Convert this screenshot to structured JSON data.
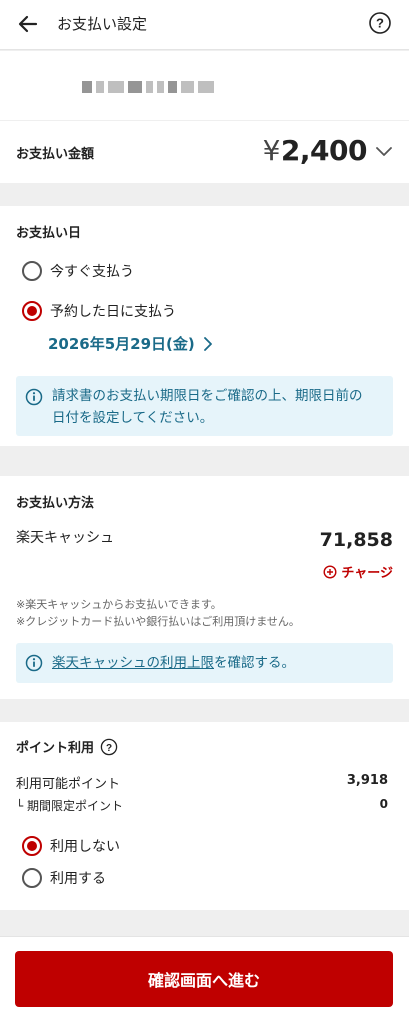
{
  "header": {
    "title": "お支払い設定"
  },
  "payee": {
    "masked_segments": [
      10,
      8,
      16,
      14,
      7,
      7,
      9,
      13,
      16
    ]
  },
  "amount": {
    "label": "お支払い金額",
    "currency": "¥",
    "value": "2,400"
  },
  "payment_date": {
    "title": "お支払い日",
    "options": [
      {
        "label": "今すぐ支払う",
        "checked": false
      },
      {
        "label": "予約した日に支払う",
        "checked": true
      }
    ],
    "selected_date": "2026年5月29日(金)",
    "info": "請求書のお支払い期限日をご確認の上、期限日前の日付を設定してください。",
    "info_line1": "請求書のお支払い期限日をご確認の上、期限日前の",
    "info_line2": "日付を設定してください。"
  },
  "payment_method": {
    "title": "お支払い方法",
    "method_name": "楽天キャッシュ",
    "balance": "71,858",
    "charge_label": "チャージ",
    "notes": [
      "※楽天キャッシュからお支払いできます。",
      "※クレジットカード払いや銀行払いはご利用頂けません。"
    ],
    "info_link": "楽天キャッシュの利用上限",
    "info_suffix": "を確認する。"
  },
  "points": {
    "title": "ポイント利用",
    "available_label": "利用可能ポイント",
    "available_value": "3,918",
    "limited_label": "└ 期間限定ポイント",
    "limited_value": "0",
    "options": [
      {
        "label": "利用しない",
        "checked": true
      },
      {
        "label": "利用する",
        "checked": false
      }
    ]
  },
  "footer": {
    "confirm_label": "確認画面へ進む"
  },
  "colors": {
    "accent": "#bf0000",
    "link": "#1a6a88",
    "info_bg": "#e6f4fa"
  }
}
